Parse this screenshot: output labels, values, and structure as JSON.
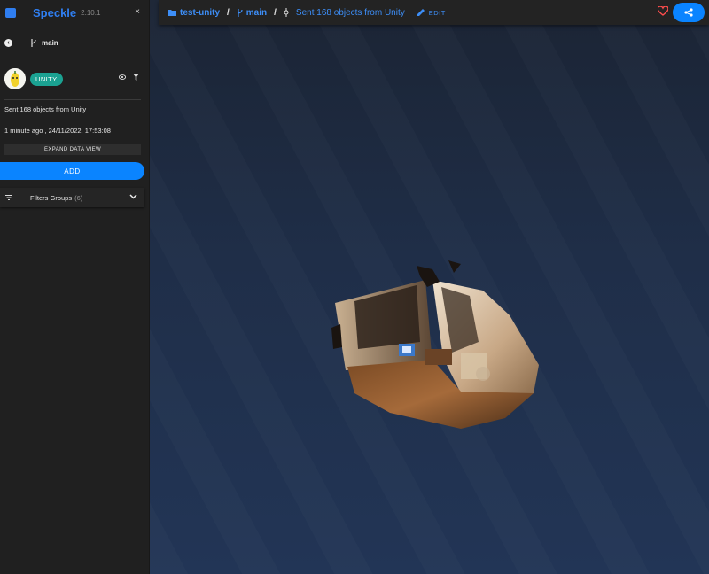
{
  "app": {
    "name": "Speckle",
    "version": "2.10.1"
  },
  "sidebar": {
    "close_label": "×",
    "branch": "main",
    "commit": {
      "source_badge": "UNITY",
      "message": "Sent 168 objects from Unity",
      "time": "1 minute ago , 24/11/2022, 17:53:08"
    },
    "expand_label": "EXPAND DATA VIEW",
    "add_label": "ADD",
    "filters": {
      "label": "Filters Groups",
      "count": "(6)"
    }
  },
  "breadcrumb": {
    "stream": "test-unity",
    "sep1": "/",
    "branch": "main",
    "sep2": "/",
    "commit": "Sent 168 objects from Unity",
    "edit_label": "EDIT"
  },
  "colors": {
    "accent": "#0a84ff",
    "badge": "#1ba292",
    "heart": "#ff4d4d"
  },
  "icons": [
    "logo-icon",
    "close-icon",
    "back-icon",
    "branch-icon",
    "eye-icon",
    "filter-icon",
    "filter-list-icon",
    "chevron-down-icon",
    "folder-icon",
    "commit-icon",
    "pencil-icon",
    "heart-icon",
    "share-icon"
  ]
}
